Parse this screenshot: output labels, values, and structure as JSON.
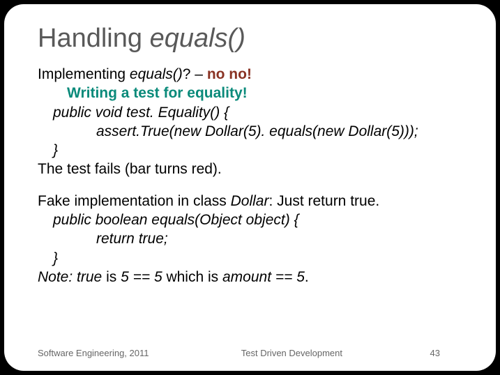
{
  "title": {
    "plain": "Handling ",
    "italic": "equals()"
  },
  "lines": {
    "l1a": "Implementing ",
    "l1b": "equals()",
    "l1c": "? – ",
    "l1d": "no no!",
    "l2": "Writing a test for equality!",
    "l3": "public void test. Equality() {",
    "l4": "assert.True(new Dollar(5). equals(new Dollar(5)));",
    "l5": "}",
    "l6": "The test fails (bar turns red).",
    "l7a": "Fake implementation in class ",
    "l7b": "Dollar",
    "l7c": ": Just return true.",
    "l8": "public boolean equals(Object object) {",
    "l9": "return true;",
    "l10": "}",
    "l11a": "Note:  true ",
    "l11b": "is ",
    "l11c": "5 == 5 ",
    "l11d": "which is ",
    "l11e": "amount == 5",
    "l11f": "."
  },
  "footer": {
    "left": "Software Engineering,   2011",
    "center": "Test Driven Development",
    "page": "43"
  }
}
